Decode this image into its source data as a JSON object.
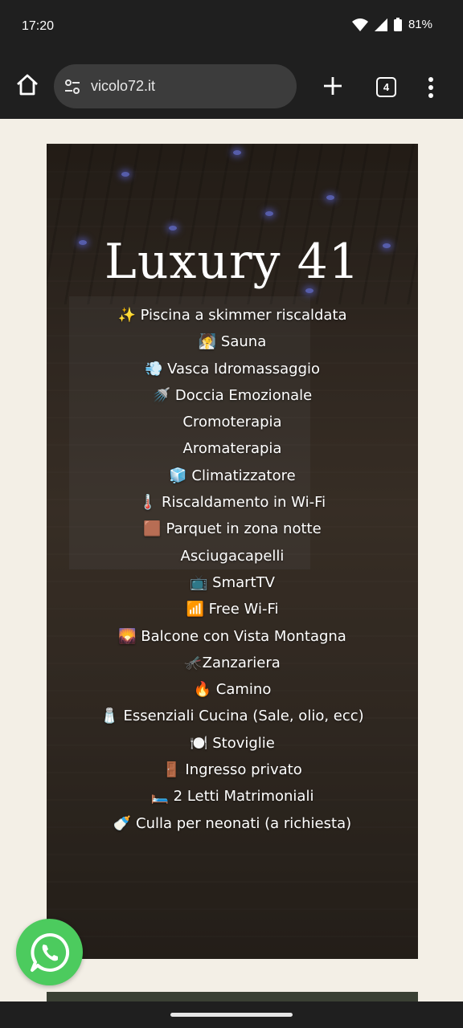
{
  "status_bar": {
    "time": "17:20",
    "battery": "81%"
  },
  "browser": {
    "url": "vicolo72.it",
    "tab_count": "4"
  },
  "hero": {
    "title": "Luxury 41",
    "amenities": [
      "✨ Piscina a skimmer riscaldata",
      "🧖 Sauna",
      "💨 Vasca Idromassaggio",
      "🚿 Doccia Emozionale",
      "Cromoterapia",
      "Aromaterapia",
      "🧊 Climatizzatore",
      "🌡️ Riscaldamento in Wi-Fi",
      "🟫 Parquet in zona notte",
      "Asciugacapelli",
      "📺 SmartTV",
      "📶 Free Wi-Fi",
      "🌄 Balcone con Vista Montagna",
      "🦟Zanzariera",
      "🔥 Camino",
      "🧂 Essenziali Cucina (Sale, olio, ecc)",
      "🍽️ Stoviglie",
      "🚪 Ingresso privato",
      "🛏️ 2 Letti Matrimoniali",
      "🍼 Culla per neonati (a richiesta)"
    ]
  },
  "colors": {
    "page_bg": "#f3efe6",
    "chrome_bg": "#1f1f1f",
    "whatsapp_green": "#4ccb5e"
  },
  "icons": [
    "home-icon",
    "site-settings-icon",
    "new-tab-icon",
    "tab-switcher-icon",
    "more-menu-icon",
    "whatsapp-icon",
    "wifi-icon",
    "signal-icon",
    "battery-icon"
  ]
}
